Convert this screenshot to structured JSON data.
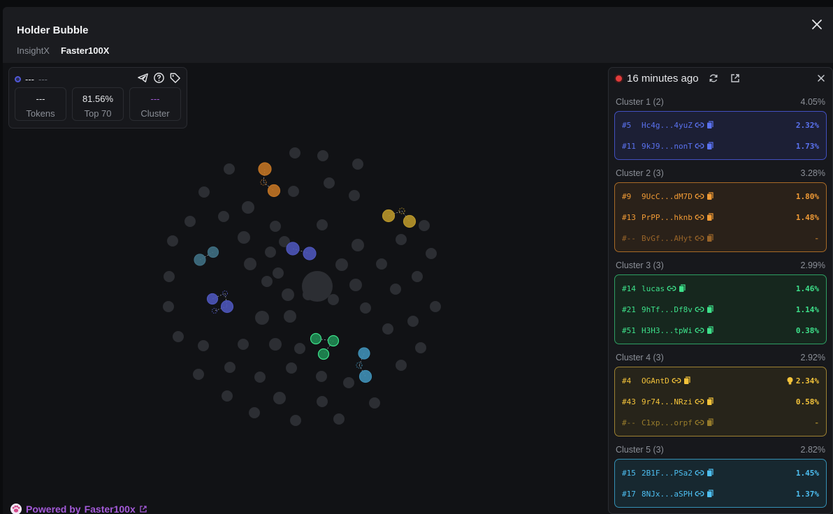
{
  "modal": {
    "title": "Holder Bubble",
    "tabs": [
      {
        "label": "InsightX",
        "active": false
      },
      {
        "label": "Faster100X",
        "active": true
      }
    ]
  },
  "stats": {
    "name": "---",
    "name2": "---",
    "cells": [
      {
        "value": "---",
        "label": "Tokens"
      },
      {
        "value": "81.56%",
        "label": "Top 70"
      },
      {
        "value": "---",
        "label": "Cluster"
      }
    ],
    "icons": [
      "telegram-icon",
      "help-icon",
      "tag-icon"
    ]
  },
  "footer": {
    "prefix": "Powered by",
    "brand": "Faster100x"
  },
  "panel": {
    "time": "16 minutes ago",
    "clusters": [
      {
        "name": "Cluster 1",
        "count": "(2)",
        "pct": "4.05%",
        "color": "#5a72f0",
        "rows": [
          {
            "rank": "#5",
            "addr": "Hc4g...4yuZ",
            "pct": "2.32%"
          },
          {
            "rank": "#11",
            "addr": "9kJ9...nonT",
            "pct": "1.73%"
          }
        ]
      },
      {
        "name": "Cluster 2",
        "count": "(3)",
        "pct": "3.28%",
        "color": "#f09a35",
        "rows": [
          {
            "rank": "#9",
            "addr": "9UcC...dM7D",
            "pct": "1.80%"
          },
          {
            "rank": "#13",
            "addr": "PrPP...hknb",
            "pct": "1.48%"
          },
          {
            "rank": "#--",
            "addr": "BvGf...AHyt",
            "pct": "-"
          }
        ]
      },
      {
        "name": "Cluster 3",
        "count": "(3)",
        "pct": "2.99%",
        "color": "#3de08a",
        "rows": [
          {
            "rank": "#14",
            "addr": "lucas",
            "pct": "1.46%"
          },
          {
            "rank": "#21",
            "addr": "9hTf...Df8v",
            "pct": "1.14%"
          },
          {
            "rank": "#51",
            "addr": "H3H3...tpWi",
            "pct": "0.38%"
          }
        ]
      },
      {
        "name": "Cluster 4",
        "count": "(3)",
        "pct": "2.92%",
        "color": "#f2c23a",
        "rows": [
          {
            "rank": "#4",
            "addr": "OGAntD",
            "pct": "2.34%",
            "bulb": true
          },
          {
            "rank": "#43",
            "addr": "9r74...NRzi",
            "pct": "0.58%"
          },
          {
            "rank": "#--",
            "addr": "C1xp...orpf",
            "pct": "-"
          }
        ]
      },
      {
        "name": "Cluster 5",
        "count": "(3)",
        "pct": "2.82%",
        "color": "#4dbef0",
        "rows": [
          {
            "rank": "#15",
            "addr": "2B1F...PSa2",
            "pct": "1.45%"
          },
          {
            "rank": "#17",
            "addr": "8NJx...aSPH",
            "pct": "1.37%"
          }
        ]
      }
    ]
  }
}
